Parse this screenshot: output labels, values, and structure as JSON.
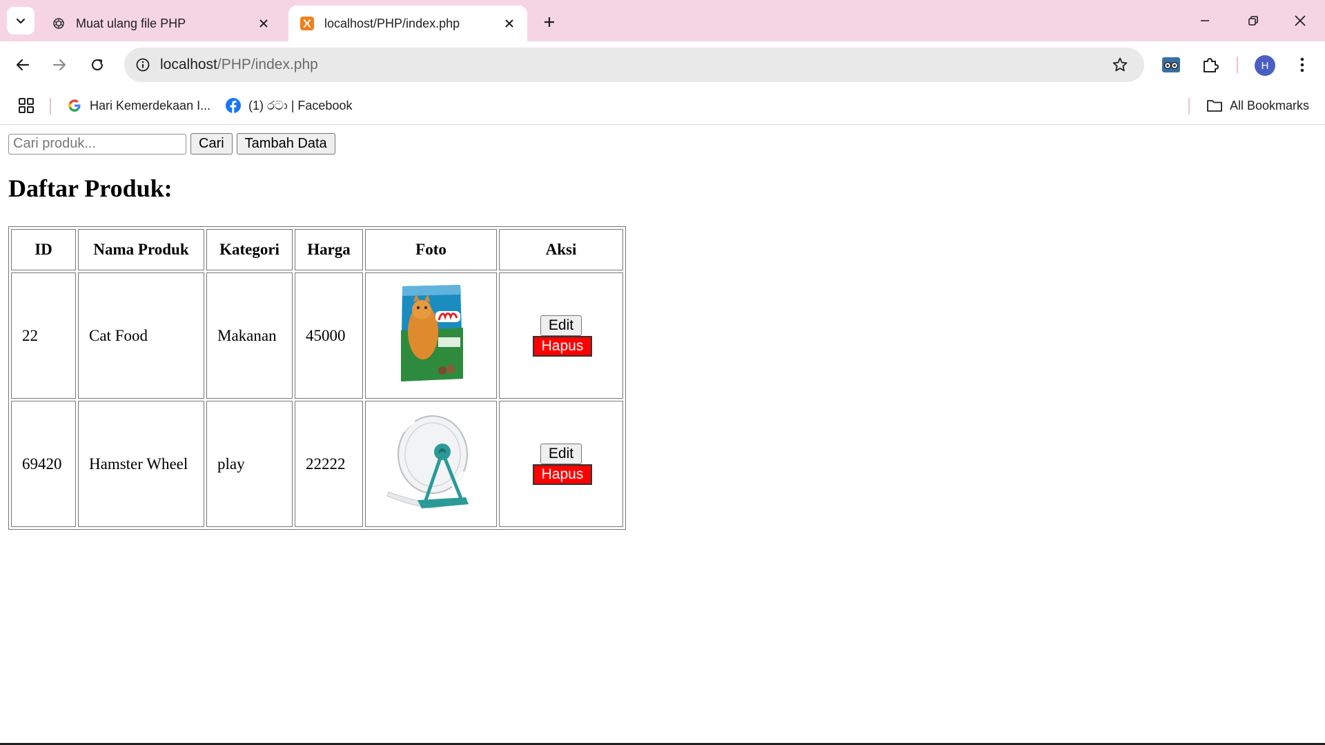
{
  "browser": {
    "tabs": [
      {
        "title": "Muat ulang file PHP",
        "icon": "chatgpt-icon",
        "active": false
      },
      {
        "title": "localhost/PHP/index.php",
        "icon": "xampp-icon",
        "active": true
      }
    ],
    "address": {
      "host": "localhost",
      "path": "/PHP/index.php"
    },
    "bookmarks": [
      {
        "label": "Hari Kemerdekaan I...",
        "icon": "google-icon"
      },
      {
        "label": "(1) රටා | Facebook",
        "icon": "facebook-icon"
      }
    ],
    "all_bookmarks_label": "All Bookmarks",
    "profile_initial": "H"
  },
  "search": {
    "placeholder": "Cari produk...",
    "value": "",
    "button_label": "Cari",
    "add_label": "Tambah Data"
  },
  "heading": "Daftar Produk:",
  "table": {
    "columns": [
      "ID",
      "Nama Produk",
      "Kategori",
      "Harga",
      "Foto",
      "Aksi"
    ],
    "rows": [
      {
        "id": "22",
        "name": "Cat Food",
        "category": "Makanan",
        "price": "45000",
        "photo": "cat-food-bag-image",
        "edit": "Edit",
        "delete": "Hapus"
      },
      {
        "id": "69420",
        "name": "Hamster Wheel",
        "category": "play",
        "price": "22222",
        "photo": "hamster-wheel-image",
        "edit": "Edit",
        "delete": "Hapus"
      }
    ]
  },
  "colors": {
    "tabbar": "#f6d5e3",
    "delete_button": "#ff0000"
  }
}
